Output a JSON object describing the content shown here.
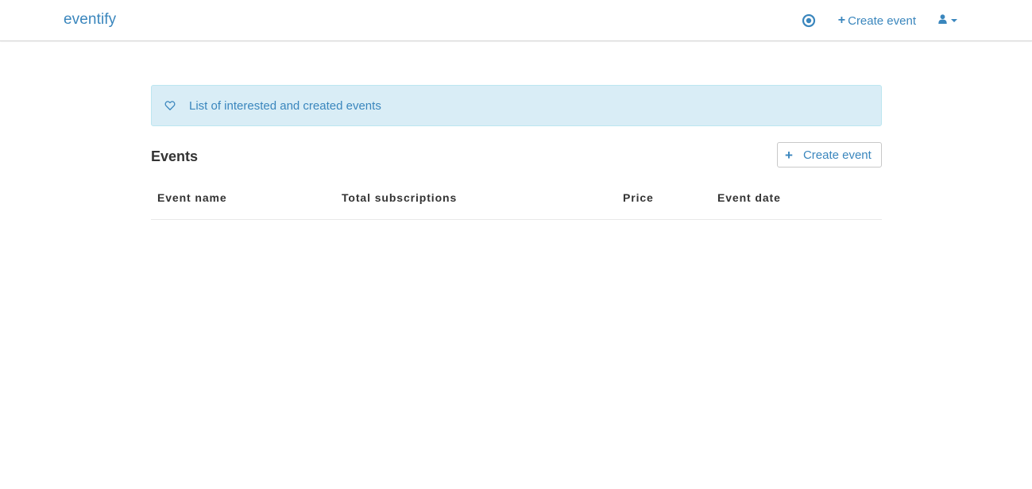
{
  "navbar": {
    "brand": "eventify",
    "create_label": "Create event",
    "icons": {
      "target": "target-icon",
      "plus": "plus-icon",
      "user": "user-icon",
      "caret": "caret-down-icon"
    }
  },
  "alert": {
    "icon": "heart-icon",
    "message": "List of interested and created events"
  },
  "events": {
    "title": "Events",
    "create_button_label": "Create event",
    "columns": [
      "Event name",
      "Total subscriptions",
      "Price",
      "Event date"
    ],
    "rows": []
  },
  "colors": {
    "accent": "#3a86bd",
    "alert_background": "#d9edf6",
    "alert_border": "#bce6f0"
  }
}
